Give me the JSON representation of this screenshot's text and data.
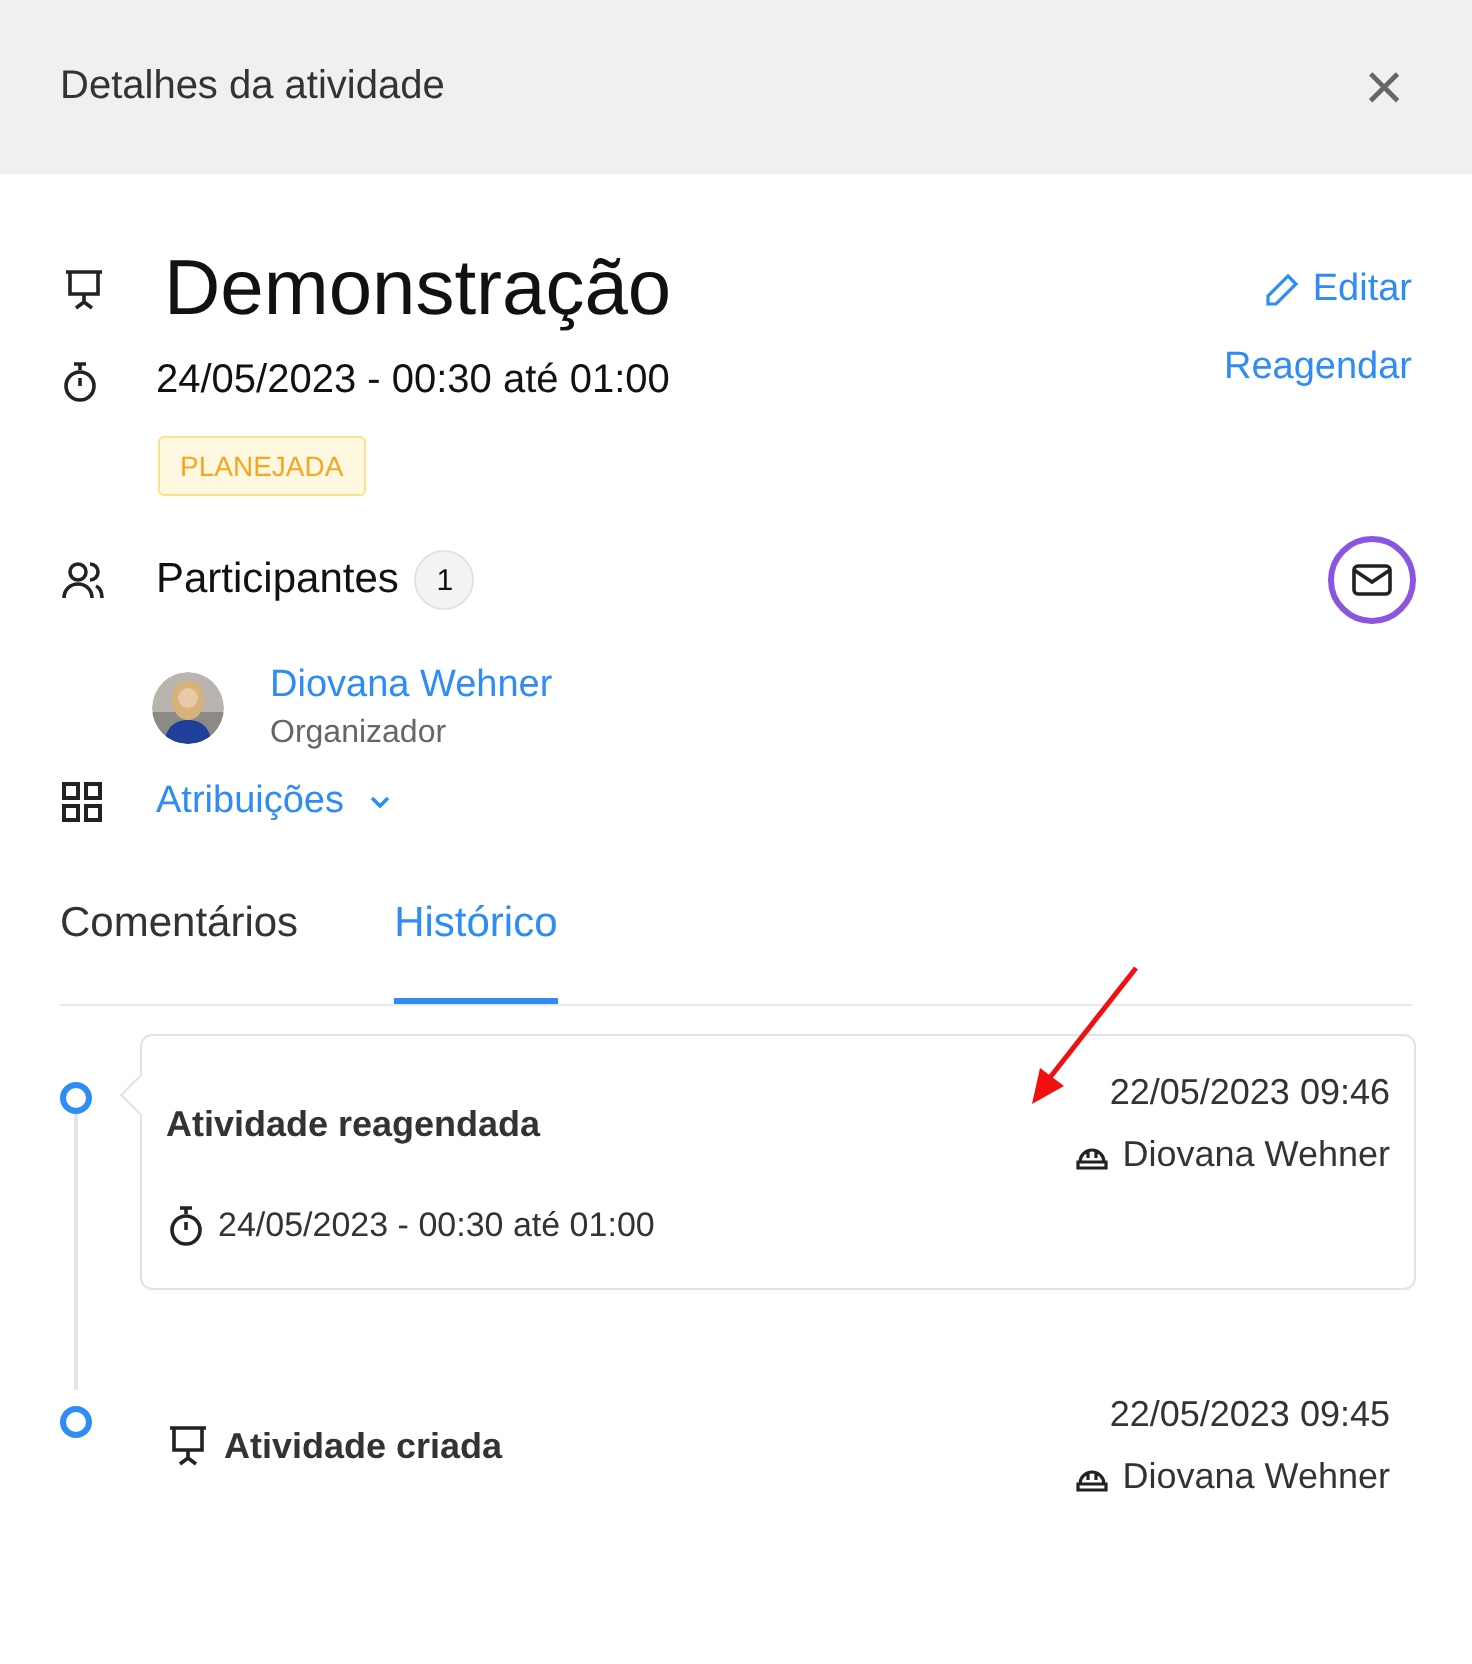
{
  "dialog": {
    "title": "Detalhes da atividade",
    "close": "×"
  },
  "activity": {
    "title": "Demonstração",
    "edit": "Editar",
    "schedule": "24/05/2023 - 00:30 até 01:00",
    "reschedule": "Reagendar",
    "status": "PLANEJADA"
  },
  "participants": {
    "label": "Participantes",
    "count": "1",
    "people": [
      {
        "name": "Diovana Wehner",
        "role": "Organizador"
      }
    ]
  },
  "assignments": {
    "label": "Atribuições",
    "expanded": false
  },
  "tabs": [
    {
      "label": "Comentários",
      "selected": false
    },
    {
      "label": "Histórico",
      "selected": true
    }
  ],
  "history": [
    {
      "kind": "card",
      "title": "Atividade reagendada",
      "time": "22/05/2023 09:46",
      "user": "Diovana Wehner",
      "detail": "24/05/2023 - 00:30 até 01:00"
    },
    {
      "kind": "plain",
      "title": "Atividade criada",
      "time": "22/05/2023 09:45",
      "user": "Diovana Wehner"
    }
  ]
}
